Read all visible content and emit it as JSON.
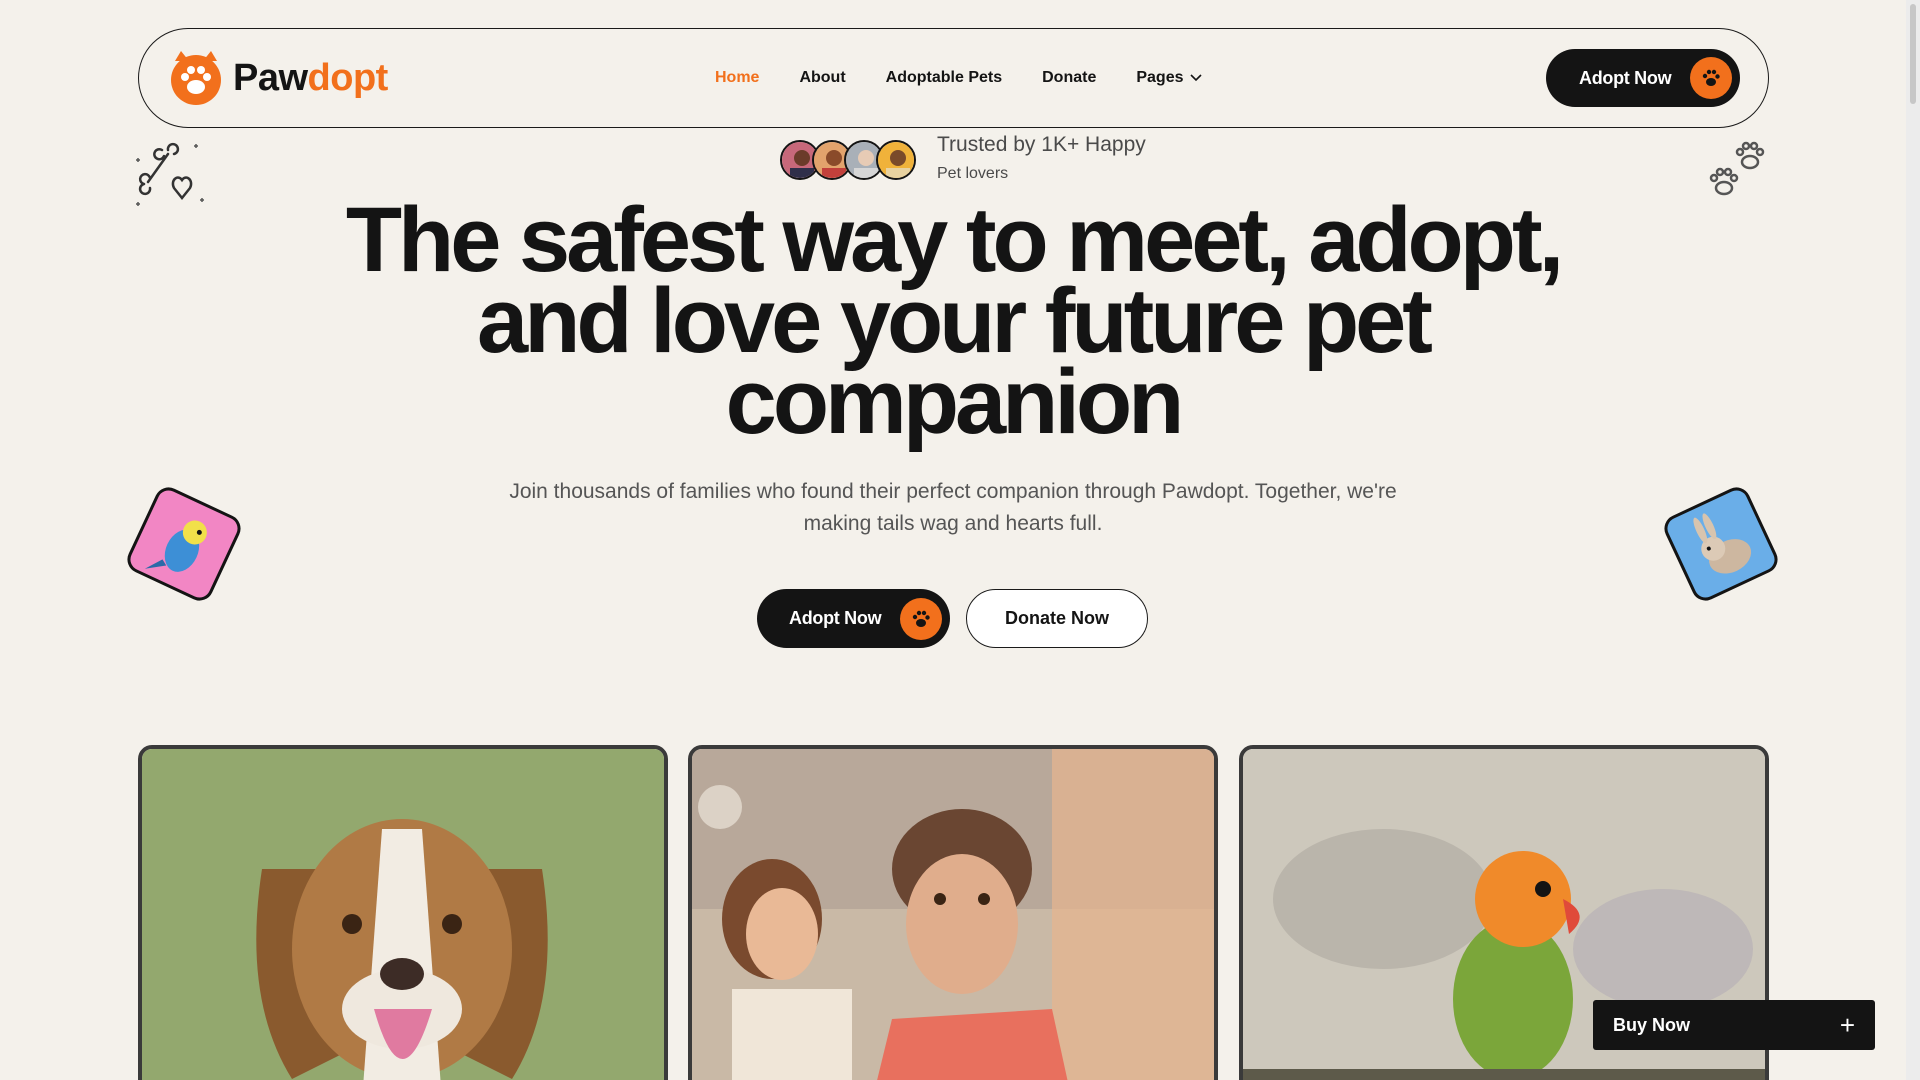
{
  "brand": {
    "name_part1": "Paw",
    "name_part2": "dopt",
    "accent": "#f2701c",
    "dark": "#141414",
    "bg": "#f4f1eb"
  },
  "nav": {
    "items": [
      {
        "label": "Home",
        "active": true
      },
      {
        "label": "About"
      },
      {
        "label": "Adoptable Pets"
      },
      {
        "label": "Donate"
      },
      {
        "label": "Pages",
        "has_dropdown": true
      }
    ],
    "cta": "Adopt Now"
  },
  "hero": {
    "trust_title": "Trusted by 1K+ Happy",
    "trust_sub": "Pet lovers",
    "headline_line1": "The safest way to meet, adopt,",
    "headline_line2": "and love your future pet",
    "headline_line3": "companion",
    "sub_line1": "Join thousands of families who found their perfect companion through Pawdopt. Together, we're",
    "sub_line2": "making tails wag and hearts full.",
    "primary_cta": "Adopt Now",
    "secondary_cta": "Donate Now"
  },
  "icons": [
    "paw-logo-icon",
    "paw-icon",
    "chevron-down-icon",
    "bone-heart-icon",
    "paw-prints-icon",
    "plus-icon"
  ],
  "cards": [
    {
      "subject": "beagle-dog-photo"
    },
    {
      "subject": "couple-selfie-photo"
    },
    {
      "subject": "lovebird-photo"
    }
  ],
  "floating": {
    "buy_now": "Buy Now"
  }
}
